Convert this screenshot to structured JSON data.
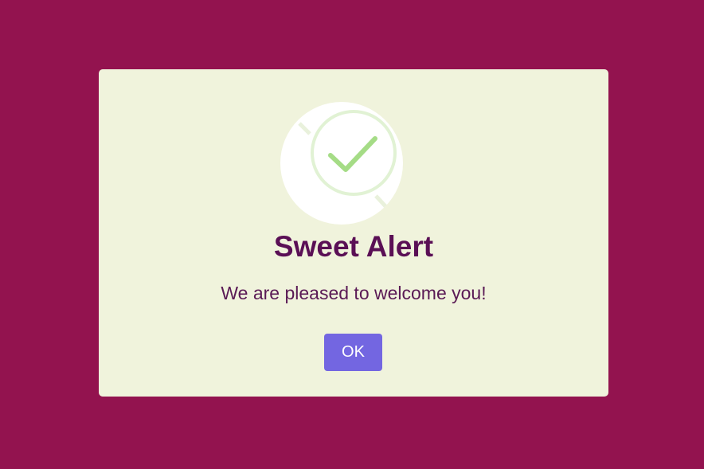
{
  "dialog": {
    "title": "Sweet Alert",
    "message": "We are pleased to welcome you!",
    "ok_label": "OK",
    "icon": "success-check-icon"
  },
  "colors": {
    "backdrop": "#93134f",
    "dialog_background": "#f0f3dc",
    "title": "#5a0f55",
    "message": "#5a1a55",
    "button": "#7366e1",
    "button_text": "#ffffff",
    "check": "#a5dc86",
    "check_ring": "#e1f2d4"
  }
}
